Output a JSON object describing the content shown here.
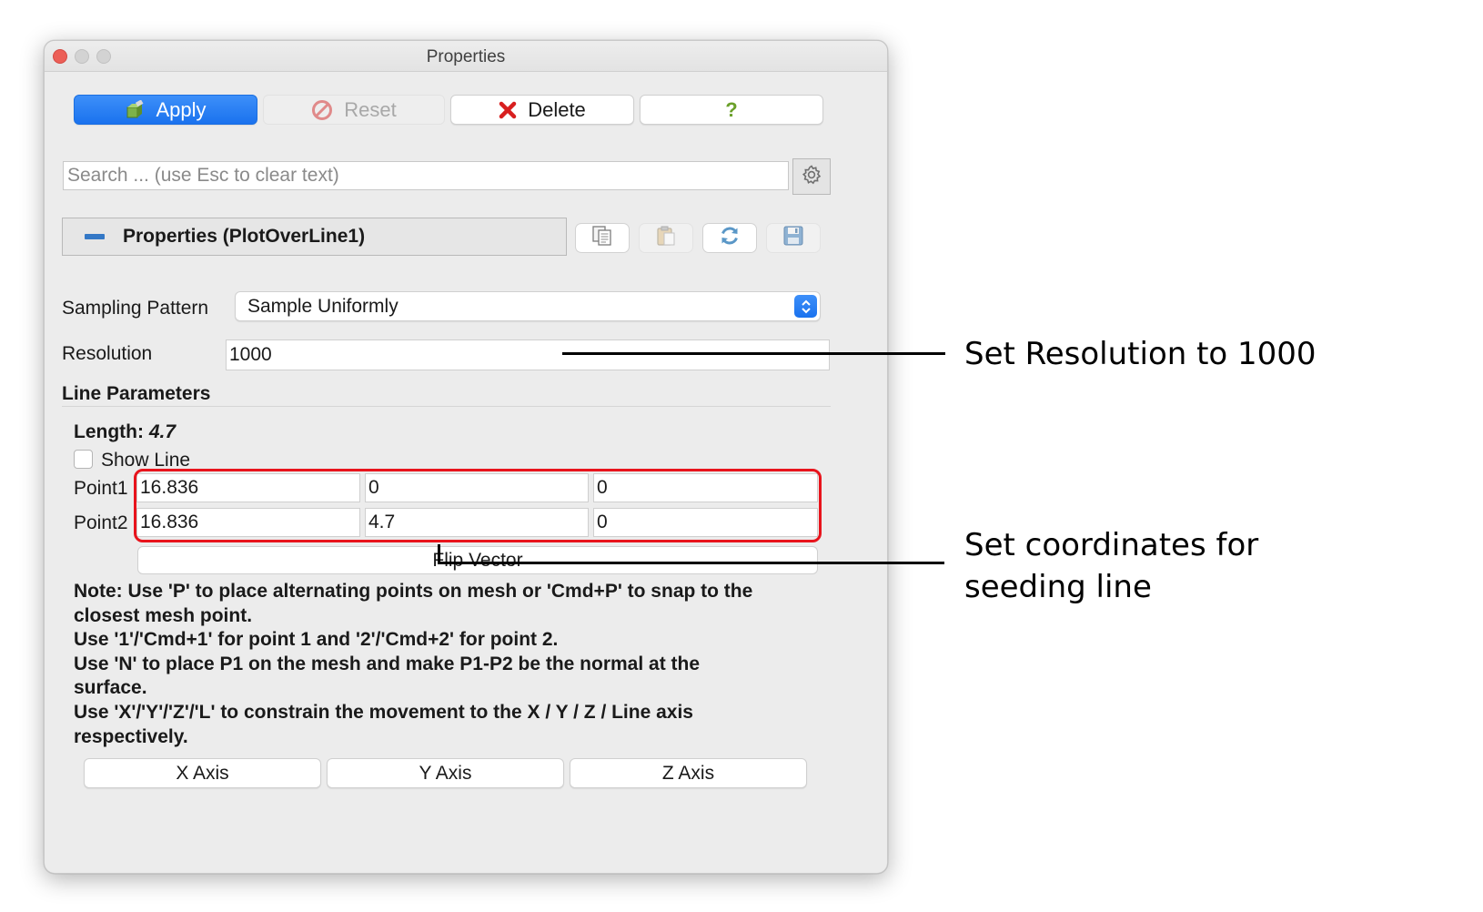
{
  "window": {
    "title": "Properties"
  },
  "toolbar": {
    "apply_label": "Apply",
    "reset_label": "Reset",
    "delete_label": "Delete",
    "help_label": "?"
  },
  "search": {
    "placeholder": "Search ... (use Esc to clear text)",
    "value": ""
  },
  "section": {
    "title": "Properties (PlotOverLine1)"
  },
  "sampling": {
    "label": "Sampling Pattern",
    "value": "Sample Uniformly"
  },
  "resolution": {
    "label": "Resolution",
    "value": "1000"
  },
  "line_params": {
    "title": "Line Parameters",
    "length_label": "Length:",
    "length_value": "4.7",
    "show_line_label": "Show Line",
    "show_line_checked": false,
    "point1": {
      "label": "Point1",
      "x": "16.836",
      "y": "0",
      "z": "0"
    },
    "point2": {
      "label": "Point2",
      "x": "16.836",
      "y": "4.7",
      "z": "0"
    },
    "flip_label": "Flip Vector"
  },
  "note": {
    "lines": [
      "Note: Use 'P' to place alternating points on mesh or 'Cmd+P' to snap to the",
      "closest mesh point.",
      "Use '1'/'Cmd+1' for point 1 and '2'/'Cmd+2' for point 2.",
      "Use 'N' to place P1 on the mesh and make P1-P2 be the normal at the",
      "surface.",
      "Use 'X'/'Y'/'Z'/'L' to constrain the movement to the X / Y / Z / Line axis",
      "respectively."
    ]
  },
  "axis_buttons": {
    "x": "X Axis",
    "y": "Y Axis",
    "z": "Z Axis"
  },
  "annotations": {
    "resolution": "Set Resolution to 1000",
    "coords_line1": "Set coordinates for",
    "coords_line2": "seeding line"
  },
  "icons": {
    "apply": "apply-icon",
    "reset": "reset-icon",
    "delete": "delete-icon",
    "gear": "gear-icon",
    "copy": "copy-icon",
    "paste": "paste-icon",
    "refresh": "refresh-icon",
    "save": "save-icon",
    "dropdown": "chevron-updown-icon"
  },
  "colors": {
    "accent": "#1a72ee",
    "highlight": "#e8141c",
    "delete": "#d81f1f",
    "help": "#6aa02a",
    "section_marker": "#3478c6"
  }
}
